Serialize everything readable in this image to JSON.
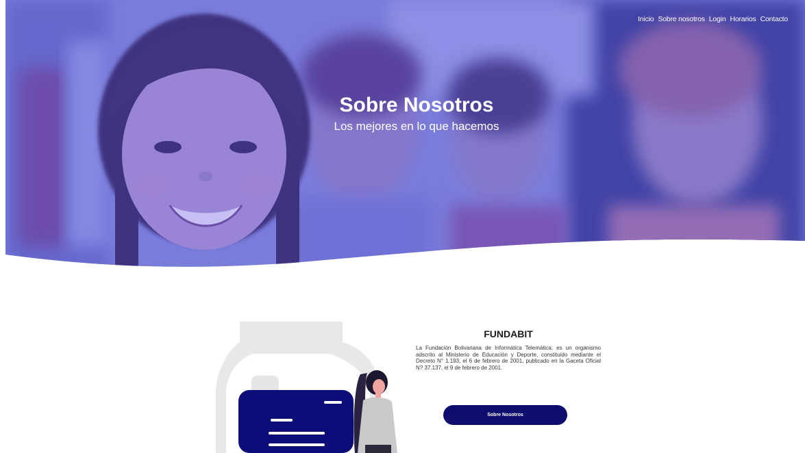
{
  "nav": {
    "items": [
      {
        "label": "Inicio"
      },
      {
        "label": "Sobre nosotros"
      },
      {
        "label": "Login"
      },
      {
        "label": "Horarios"
      },
      {
        "label": "Contacto"
      }
    ]
  },
  "hero": {
    "title": "Sobre Nosotros",
    "subtitle": "Los mejores en lo que hacemos",
    "overlay_color": "#5a5ad8"
  },
  "about": {
    "title": "FUNDABIT",
    "body": "La Fundación Bolivariana de Informática Telemática; es un organismo adscrito al Ministerio de Educación y Deporte, constituido mediante el Decreto N° 1.193, el 6 de febrero de 2001, publicado en la Gaceta Oficial N? 37.137, el 9 de febrero de 2001.",
    "button_label": "Sobre Nosotros",
    "accent_color": "#0d0d6e"
  }
}
